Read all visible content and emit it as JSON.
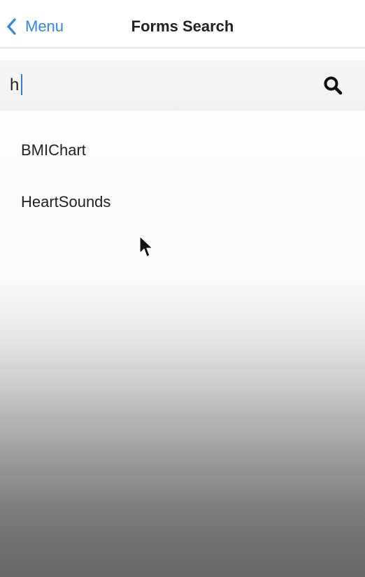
{
  "nav": {
    "back_label": "Menu",
    "title": "Forms Search",
    "back_icon": "chevron-left-icon",
    "accent_color": "#3a86d6"
  },
  "search": {
    "value": "h",
    "icon": "search-icon"
  },
  "results": [
    {
      "label": "BMIChart"
    },
    {
      "label": "HeartSounds"
    }
  ]
}
